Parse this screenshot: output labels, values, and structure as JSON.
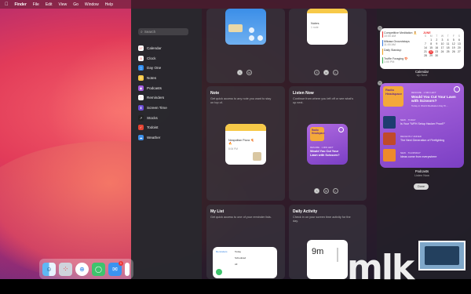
{
  "menubar": {
    "apple": "",
    "app": "Finder",
    "items": [
      "File",
      "Edit",
      "View",
      "Go",
      "Window",
      "Help"
    ]
  },
  "search": {
    "placeholder": "Search"
  },
  "widget_list": [
    {
      "label": "Calendar",
      "color": "#ffffff",
      "glyph": "17"
    },
    {
      "label": "Clock",
      "color": "#ffffff",
      "glyph": "◷"
    },
    {
      "label": "Day One",
      "color": "#2d8cf0",
      "glyph": "◻"
    },
    {
      "label": "Notes",
      "color": "#f7c948",
      "glyph": "≡"
    },
    {
      "label": "Podcasts",
      "color": "#a35ce0",
      "glyph": "◉"
    },
    {
      "label": "Reminders",
      "color": "#ffffff",
      "glyph": "⋮"
    },
    {
      "label": "Screen Time",
      "color": "#6a4bd6",
      "glyph": "⧗"
    },
    {
      "label": "Stocks",
      "color": "#222222",
      "glyph": "↗"
    },
    {
      "label": "Todoist",
      "color": "#e44332",
      "glyph": "✓"
    },
    {
      "label": "Weather",
      "color": "#3b8ee8",
      "glyph": "☁"
    }
  ],
  "top_row": {
    "notes_label": "Notes",
    "notes_sub": "1 note",
    "sizes": [
      "S",
      "M",
      "L"
    ]
  },
  "note_panel": {
    "title": "Note",
    "desc": "Get quick access to any note you want to stay on top of.",
    "card_title": "Neapolitan Pizza 🍕🔥",
    "card_time": "8:06 PM",
    "sizes": [
      "S",
      "M"
    ]
  },
  "listen_panel": {
    "title": "Listen Now",
    "desc": "Continue from where you left off or see what's up next.",
    "art": "Radio Headspace",
    "tag": "RESUME · 1 MIN LEFT",
    "episode": "Would You Cut Your Lawn with Scissors?",
    "sizes": [
      "S",
      "M",
      "L"
    ]
  },
  "mylist_panel": {
    "title": "My List",
    "desc": "Get quick access to one of your reminder lists.",
    "list_name": "Reminders",
    "items": [
      "Today",
      "Scheduled",
      "All"
    ]
  },
  "daily_panel": {
    "title": "Daily Activity",
    "desc": "Check in on your screen time activity for the day.",
    "time": "9m"
  },
  "calendar_widget": {
    "events": [
      {
        "title": "Competitive Meditation 🧘",
        "time": "10:00 AM",
        "color": "#e33"
      },
      {
        "title": "Mikasa Groundstays",
        "time": "11:00 AM",
        "color": "#3a7be0"
      },
      {
        "title": "Daily Standup",
        "time": "",
        "color": "#f0a020"
      },
      {
        "title": "Truffle Foraging 🍄",
        "time": "1:00 PM",
        "color": "#2eaa4a"
      }
    ],
    "month": "JUNE",
    "weekdays": [
      "S",
      "M",
      "T",
      "W",
      "T",
      "F",
      "S"
    ],
    "weeks": [
      [
        "",
        "1",
        "2",
        "3",
        "4",
        "5",
        "6"
      ],
      [
        "7",
        "8",
        "9",
        "10",
        "11",
        "12",
        "13"
      ],
      [
        "14",
        "15",
        "16",
        "17",
        "18",
        "19",
        "20"
      ],
      [
        "21",
        "22",
        "23",
        "24",
        "25",
        "26",
        "27"
      ],
      [
        "28",
        "29",
        "30",
        "",
        "",
        "",
        ""
      ]
    ],
    "today": "22",
    "caption": "Calendar",
    "subcaption": "Up Next"
  },
  "podcast_widget": {
    "art": "Radio Headspace",
    "tag": "RESUME · 1 MIN LEFT",
    "episode": "Would You Cut Your Lawn with Scissors?",
    "show": "Today in World Meditation Day 5/…",
    "rows": [
      {
        "tag": "NEW · TODAY",
        "title": "Is Your \"WFH Setup Hacker Proof?\""
      },
      {
        "tag": "RECENTLY ADDED",
        "title": "The Next Generation of Firefighting"
      },
      {
        "tag": "NEW · THURSDAY",
        "title": "Ideas come from everywhere"
      }
    ],
    "caption": "Podcasts",
    "subcaption": "Listen Now",
    "done": "Done"
  },
  "dock": {
    "badge": "1"
  },
  "watermark": "mlk"
}
